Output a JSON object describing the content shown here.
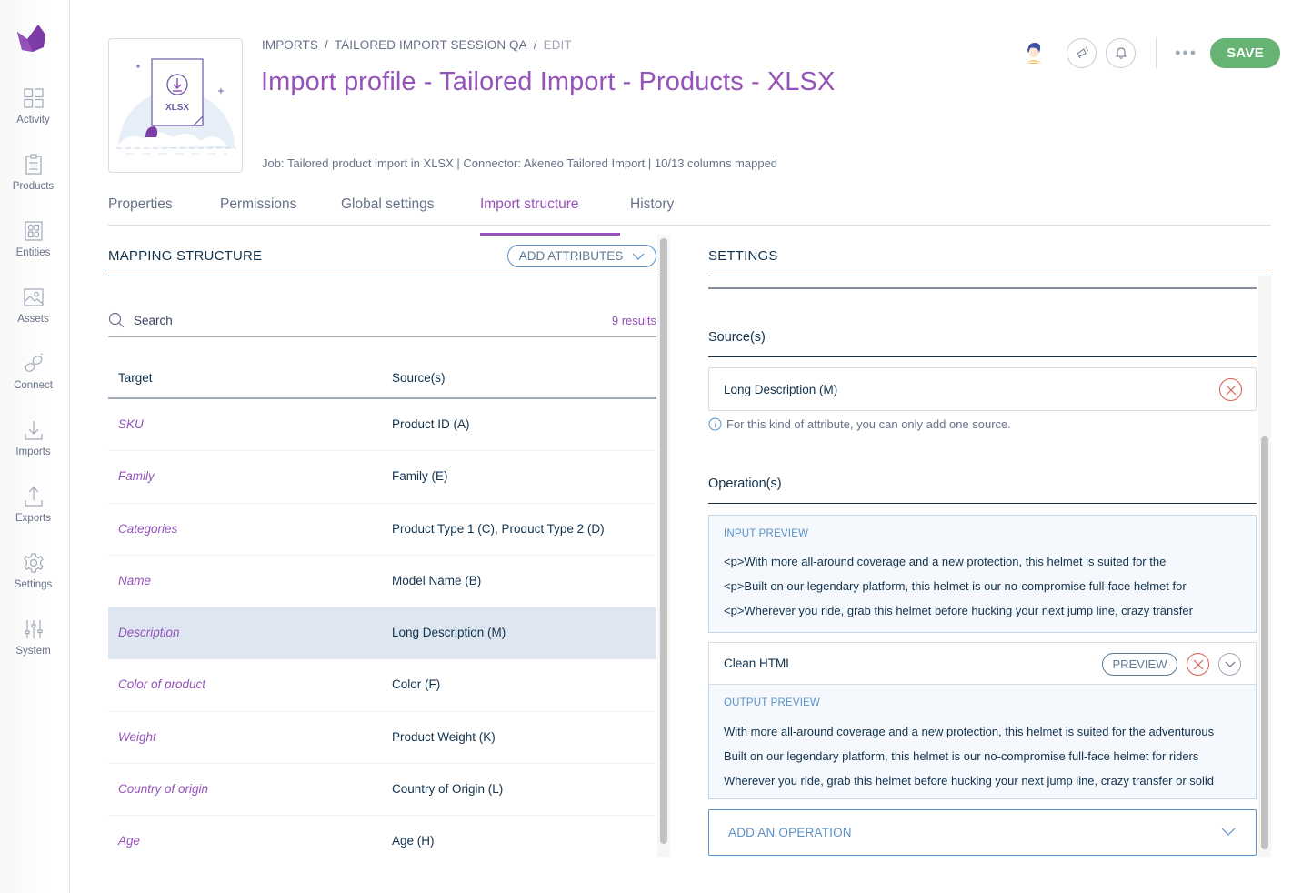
{
  "brand": {
    "accent": "#9452ba",
    "save_color": "#67b373",
    "link_blue": "#5992c7",
    "danger": "#d4604f"
  },
  "sidebar": {
    "logo": "akeneo-logo",
    "items": [
      {
        "label": "Activity",
        "icon": "activity-grid-icon"
      },
      {
        "label": "Products",
        "icon": "clipboard-icon"
      },
      {
        "label": "Entities",
        "icon": "entities-icon"
      },
      {
        "label": "Assets",
        "icon": "image-icon"
      },
      {
        "label": "Connect",
        "icon": "link-icon"
      },
      {
        "label": "Imports",
        "icon": "import-icon"
      },
      {
        "label": "Exports",
        "icon": "export-icon"
      },
      {
        "label": "Settings",
        "icon": "gear-icon"
      },
      {
        "label": "System",
        "icon": "sliders-icon"
      }
    ]
  },
  "header": {
    "thumbnail_label": "XLSX",
    "breadcrumb": [
      "IMPORTS",
      "TAILORED IMPORT SESSION QA",
      "EDIT"
    ],
    "breadcrumb_sep": "/",
    "title": "Import profile - Tailored Import - Products - XLSX",
    "meta": "Job: Tailored product import in XLSX | Connector: Akeneo Tailored Import | 10/13 columns mapped",
    "actions": {
      "avatar": "user-avatar",
      "announcements_icon": "megaphone-icon",
      "notifications_icon": "bell-icon",
      "more_label": "•••",
      "save_label": "SAVE"
    }
  },
  "tabs": [
    {
      "label": "Properties",
      "active": false
    },
    {
      "label": "Permissions",
      "active": false
    },
    {
      "label": "Global settings",
      "active": false
    },
    {
      "label": "Import structure",
      "active": true
    },
    {
      "label": "History",
      "active": false
    }
  ],
  "mapping": {
    "title": "MAPPING STRUCTURE",
    "add_attributes_label": "ADD ATTRIBUTES",
    "search_placeholder": "Search",
    "results_label": "9 results",
    "columns": [
      "Target",
      "Source(s)"
    ],
    "rows": [
      {
        "target": "SKU",
        "source": "Product ID (A)",
        "selected": false
      },
      {
        "target": "Family",
        "source": "Family (E)",
        "selected": false
      },
      {
        "target": "Categories",
        "source": "Product Type 1 (C), Product Type 2 (D)",
        "selected": false
      },
      {
        "target": "Name",
        "source": "Model Name (B)",
        "selected": false
      },
      {
        "target": "Description",
        "source": "Long Description (M)",
        "selected": true
      },
      {
        "target": "Color of product",
        "source": "Color (F)",
        "selected": false
      },
      {
        "target": "Weight",
        "source": "Product Weight (K)",
        "selected": false
      },
      {
        "target": "Country of origin",
        "source": "Country of Origin (L)",
        "selected": false
      },
      {
        "target": "Age",
        "source": "Age (H)",
        "selected": false
      }
    ]
  },
  "settings": {
    "title": "SETTINGS",
    "sources_title": "Source(s)",
    "source_value": "Long Description (M)",
    "source_helper": "For this kind of attribute, you can only add one source.",
    "operations_title": "Operation(s)",
    "input_preview": {
      "label": "INPUT PREVIEW",
      "lines": [
        "<p>With more all-around coverage and a new protection, this helmet is suited for the",
        "<p>Built on our legendary platform, this helmet is our no-compromise full-face helmet for",
        "<p>Wherever you ride, grab this helmet before hucking your next jump line, crazy transfer"
      ]
    },
    "operation": {
      "label": "Clean HTML",
      "preview_button": "PREVIEW"
    },
    "output_preview": {
      "label": "OUTPUT PREVIEW",
      "lines": [
        "With more all-around coverage and a new protection, this helmet is suited for the adventurous",
        "Built on our legendary platform, this helmet is our no-compromise full-face helmet for riders",
        "Wherever you ride, grab this helmet before hucking your next jump line, crazy transfer or solid"
      ]
    },
    "add_operation_label": "ADD AN OPERATION"
  }
}
